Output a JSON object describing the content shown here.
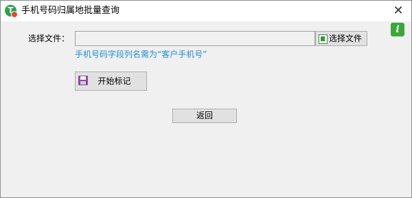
{
  "window": {
    "title": "手机号码归属地批量查询",
    "close_glyph": "✕"
  },
  "info": {
    "glyph": "i"
  },
  "file": {
    "label": "选择文件：",
    "value": "",
    "pick_button": "选择文件"
  },
  "hint": "手机号码字段列名需为“客户手机号”",
  "actions": {
    "start_label": "开始标记",
    "back_label": "返回"
  }
}
